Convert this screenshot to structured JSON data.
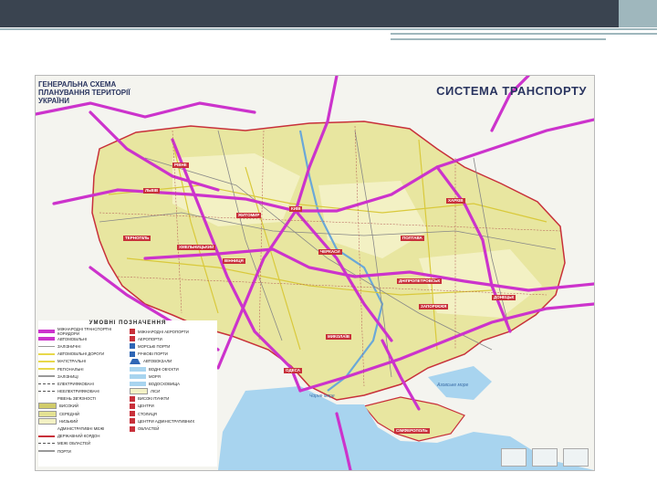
{
  "map": {
    "title_left": "ГЕНЕРАЛЬНА СХЕМА\nПЛАНУВАННЯ ТЕРИТОРІЇ\nУКРАЇНИ",
    "title_right": "СИСТЕМА ТРАНСПОРТУ",
    "cities": [
      "КИЇВ",
      "ЛЬВІВ",
      "ХАРКІВ",
      "ДНІПРОПЕТРОВСЬК",
      "ОДЕСА",
      "СІМФЕРОПОЛЬ",
      "ЗАПОРІЖЖЯ",
      "ВІННИЦЯ",
      "РІВНЕ",
      "ЖИТОМИР",
      "ТЕРНОПІЛЬ",
      "ХМЕЛЬНИЦЬКИЙ",
      "МИКОЛАЇВ",
      "ПОЛТАВА",
      "ЧЕРКАСИ",
      "ДОНЕЦЬК"
    ],
    "seas": [
      "Чорне море",
      "Азовське море"
    ]
  },
  "legend": {
    "title": "УМОВНІ ПОЗНАЧЕННЯ",
    "left": [
      "МІЖНАРОДНІ ТРАНСПОРТНІ КОРИДОРИ",
      "АВТОМОБІЛЬНІ",
      "ЗАЛІЗНИЧНІ",
      "АВТОМОБІЛЬНІ ДОРОГИ",
      "МАГІСТРАЛЬНІ",
      "РЕГІОНАЛЬНІ",
      "ЗАЛІЗНИЦІ",
      "ЕЛЕКТРИФІКОВАНІ",
      "НЕЕЛЕКТРИФІКОВАНІ",
      "РІВЕНЬ ЗВ'ЯЗНОСТІ",
      "ВИСОКИЙ",
      "СЕРЕДНІЙ",
      "НИЗЬКИЙ",
      "АДМІНІСТРАТИВНІ МЕЖІ",
      "ДЕРЖАВНИЙ КОРДОН",
      "МЕЖІ ОБЛАСТЕЙ",
      "ПОРТИ"
    ],
    "right": [
      "МІЖНАРОДНІ АЕРОПОРТИ",
      "АЕРОПОРТИ",
      "МОРСЬКІ ПОРТИ",
      "РІЧКОВІ ПОРТИ",
      "АВТОВОКЗАЛИ",
      "ВОДНІ ОБ'ЄКТИ",
      "МОРЯ",
      "ВОДОСХОВИЩА",
      "ЛІСИ",
      "ВИСОКІ ПУНКТИ",
      "ЦЕНТРИ",
      "СТОЛИЦЯ",
      "ЦЕНТРИ АДМІНІСТРАТИВНИХ",
      "ОБЛАСТЕЙ"
    ]
  },
  "colors": {
    "corridor": "#cc33cc",
    "territory": "#e4e293",
    "sea": "#a8d4ef",
    "city": "#c8303a"
  }
}
